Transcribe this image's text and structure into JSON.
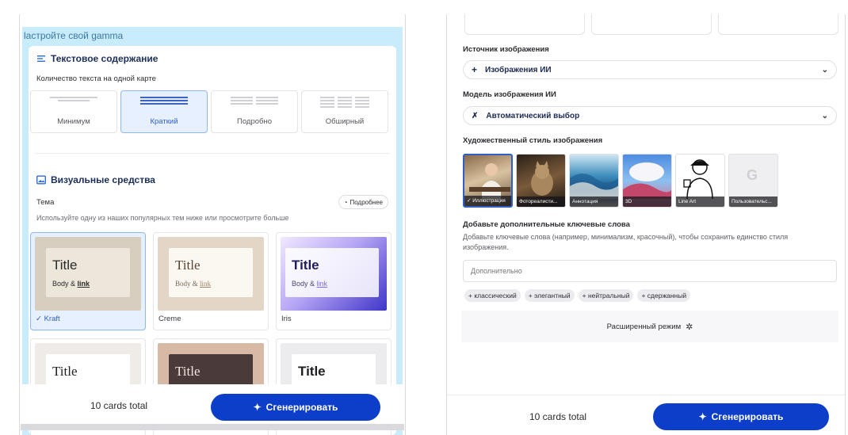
{
  "left": {
    "header_text": "lастройте свой gamma",
    "text_section": {
      "title": "Текстовое содержание",
      "amount_label": "Количество текста на одной карте",
      "options": [
        {
          "label": "Минимум",
          "selected": false
        },
        {
          "label": "Краткий",
          "selected": true
        },
        {
          "label": "Подробно",
          "selected": false
        },
        {
          "label": "Обширный",
          "selected": false
        }
      ]
    },
    "visual_section": {
      "title": "Визуальные средства",
      "theme_label": "Тема",
      "more_button": "Подробнее",
      "hint": "Используйте одну из наших популярных тем ниже или просмотрите больше",
      "themes": [
        {
          "name": "✓ Kraft",
          "title": "Title",
          "body": "Body & ",
          "link": "link",
          "selected": true
        },
        {
          "name": "Creme",
          "title": "Title",
          "body": "Body & ",
          "link": "link",
          "selected": false
        },
        {
          "name": "Iris",
          "title": "Title",
          "body": "Body & ",
          "link": "link",
          "selected": false
        },
        {
          "title": "Title"
        },
        {
          "title": "Title"
        },
        {
          "title": "Title"
        }
      ]
    },
    "footer": {
      "count": "10 cards total",
      "generate": "Сгенерировать"
    }
  },
  "right": {
    "image_source_label": "Источник изображения",
    "image_source_value": "Изображения ИИ",
    "model_label": "Модель изображения ИИ",
    "model_value": "Автоматический выбор",
    "style_label": "Художественный стиль изображения",
    "styles": [
      {
        "name": "✓ Иллюстрация",
        "selected": true
      },
      {
        "name": "Фотореалисти...",
        "selected": false
      },
      {
        "name": "Аннотация",
        "selected": false
      },
      {
        "name": "3D",
        "selected": false
      },
      {
        "name": "Line Art",
        "selected": false
      },
      {
        "name": "Пользовательс...",
        "selected": false
      }
    ],
    "keywords_label": "Добавьте дополнительные ключевые слова",
    "keywords_hint": "Добавьте ключевые слова (например, минимализм, красочный), чтобы сохранить единство стиля изображения.",
    "keywords_placeholder": "Дополнительно",
    "chips": [
      "+ классический",
      "+ элегантный",
      "+ нейтральный",
      "+ сдержанный"
    ],
    "advanced": "Расширенный режим",
    "footer": {
      "count": "10 cards total",
      "generate": "Сгенерировать"
    }
  }
}
